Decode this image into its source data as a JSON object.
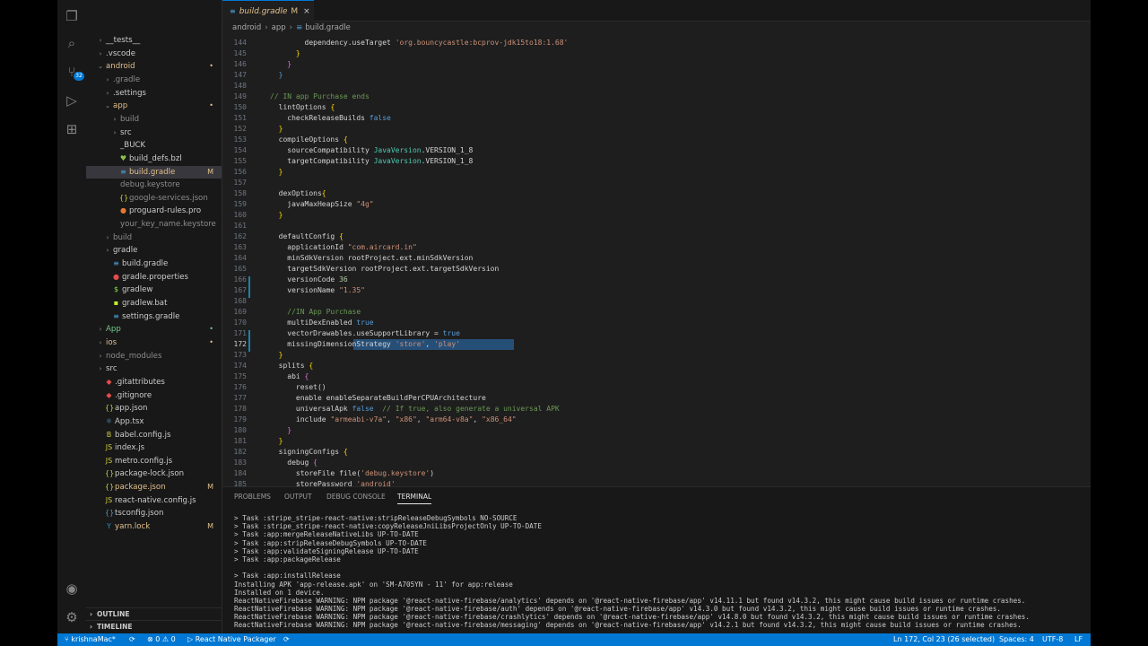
{
  "tab": {
    "icon": "gradle-icon",
    "label": "build.gradle",
    "status": "M",
    "close": "×"
  },
  "breadcrumb": [
    "android",
    "app",
    "build.gradle"
  ],
  "explorer": [
    {
      "depth": 1,
      "chev": "›",
      "label": "__tests__",
      "color": "#cccccc",
      "stat": ""
    },
    {
      "depth": 1,
      "chev": "›",
      "label": ".vscode",
      "color": "#cccccc",
      "stat": ""
    },
    {
      "depth": 1,
      "chev": "⌄",
      "label": "android",
      "color": "#e2c08d",
      "stat": "•"
    },
    {
      "depth": 2,
      "chev": "›",
      "label": ".gradle",
      "color": "#8c8c8c",
      "stat": ""
    },
    {
      "depth": 2,
      "chev": "›",
      "label": ".settings",
      "color": "#cccccc",
      "stat": ""
    },
    {
      "depth": 2,
      "chev": "⌄",
      "label": "app",
      "color": "#e2c08d",
      "stat": "•"
    },
    {
      "depth": 3,
      "chev": "›",
      "label": "build",
      "color": "#8c8c8c",
      "stat": ""
    },
    {
      "depth": 3,
      "chev": "›",
      "label": "src",
      "color": "#cccccc",
      "stat": ""
    },
    {
      "depth": 3,
      "chev": "",
      "label": "_BUCK",
      "color": "#cccccc",
      "stat": ""
    },
    {
      "depth": 3,
      "chev": "",
      "icon": "♥",
      "iconColor": "#8bc34a",
      "label": "build_defs.bzl",
      "color": "#cccccc",
      "stat": ""
    },
    {
      "depth": 3,
      "chev": "",
      "icon": "≡",
      "iconColor": "#4aa3d9",
      "label": "build.gradle",
      "color": "#e2c08d",
      "stat": "M",
      "sel": true
    },
    {
      "depth": 3,
      "chev": "",
      "label": "debug.keystore",
      "color": "#8c8c8c",
      "stat": ""
    },
    {
      "depth": 3,
      "chev": "",
      "icon": "{}",
      "iconColor": "#cbcb41",
      "label": "google-services.json",
      "color": "#8c8c8c",
      "stat": ""
    },
    {
      "depth": 3,
      "chev": "",
      "icon": "●",
      "iconColor": "#e37933",
      "label": "proguard-rules.pro",
      "color": "#cccccc",
      "stat": ""
    },
    {
      "depth": 3,
      "chev": "",
      "label": "your_key_name.keystore",
      "color": "#8c8c8c",
      "stat": ""
    },
    {
      "depth": 2,
      "chev": "›",
      "label": "build",
      "color": "#8c8c8c",
      "stat": ""
    },
    {
      "depth": 2,
      "chev": "›",
      "label": "gradle",
      "color": "#cccccc",
      "stat": ""
    },
    {
      "depth": 2,
      "chev": "",
      "icon": "≡",
      "iconColor": "#4aa3d9",
      "label": "build.gradle",
      "color": "#cccccc",
      "stat": ""
    },
    {
      "depth": 2,
      "chev": "",
      "icon": "●",
      "iconColor": "#e34c4c",
      "label": "gradle.properties",
      "color": "#cccccc",
      "stat": ""
    },
    {
      "depth": 2,
      "chev": "",
      "icon": "$",
      "iconColor": "#89e051",
      "label": "gradlew",
      "color": "#cccccc",
      "stat": ""
    },
    {
      "depth": 2,
      "chev": "",
      "icon": "▪",
      "iconColor": "#c1f12e",
      "label": "gradlew.bat",
      "color": "#cccccc",
      "stat": ""
    },
    {
      "depth": 2,
      "chev": "",
      "icon": "≡",
      "iconColor": "#4aa3d9",
      "label": "settings.gradle",
      "color": "#cccccc",
      "stat": ""
    },
    {
      "depth": 1,
      "chev": "›",
      "label": "App",
      "color": "#73c991",
      "stat": "•",
      "statColor": "#73c991"
    },
    {
      "depth": 1,
      "chev": "›",
      "label": "ios",
      "color": "#e2c08d",
      "stat": "•"
    },
    {
      "depth": 1,
      "chev": "›",
      "label": "node_modules",
      "color": "#8c8c8c",
      "stat": ""
    },
    {
      "depth": 1,
      "chev": "›",
      "label": "src",
      "color": "#cccccc",
      "stat": ""
    },
    {
      "depth": 1,
      "chev": "",
      "icon": "◆",
      "iconColor": "#e34c4c",
      "label": ".gitattributes",
      "color": "#cccccc",
      "stat": ""
    },
    {
      "depth": 1,
      "chev": "",
      "icon": "◆",
      "iconColor": "#e34c4c",
      "label": ".gitignore",
      "color": "#cccccc",
      "stat": ""
    },
    {
      "depth": 1,
      "chev": "",
      "icon": "{}",
      "iconColor": "#cbcb41",
      "label": "app.json",
      "color": "#cccccc",
      "stat": ""
    },
    {
      "depth": 1,
      "chev": "",
      "icon": "⚛",
      "iconColor": "#519aba",
      "label": "App.tsx",
      "color": "#cccccc",
      "stat": ""
    },
    {
      "depth": 1,
      "chev": "",
      "icon": "B",
      "iconColor": "#cbcb41",
      "label": "babel.config.js",
      "color": "#cccccc",
      "stat": ""
    },
    {
      "depth": 1,
      "chev": "",
      "icon": "JS",
      "iconColor": "#cbcb41",
      "label": "index.js",
      "color": "#cccccc",
      "stat": ""
    },
    {
      "depth": 1,
      "chev": "",
      "icon": "JS",
      "iconColor": "#cbcb41",
      "label": "metro.config.js",
      "color": "#cccccc",
      "stat": ""
    },
    {
      "depth": 1,
      "chev": "",
      "icon": "{}",
      "iconColor": "#cbcb41",
      "label": "package-lock.json",
      "color": "#cccccc",
      "stat": ""
    },
    {
      "depth": 1,
      "chev": "",
      "icon": "{}",
      "iconColor": "#cbcb41",
      "label": "package.json",
      "color": "#e2c08d",
      "stat": "M"
    },
    {
      "depth": 1,
      "chev": "",
      "icon": "JS",
      "iconColor": "#cbcb41",
      "label": "react-native.config.js",
      "color": "#cccccc",
      "stat": ""
    },
    {
      "depth": 1,
      "chev": "",
      "icon": "{}",
      "iconColor": "#519aba",
      "label": "tsconfig.json",
      "color": "#cccccc",
      "stat": ""
    },
    {
      "depth": 1,
      "chev": "",
      "icon": "Y",
      "iconColor": "#2c8ebb",
      "label": "yarn.lock",
      "color": "#e2c08d",
      "stat": "M"
    }
  ],
  "sections": {
    "outline": "OUTLINE",
    "timeline": "TIMELINE"
  },
  "code": [
    {
      "n": "144",
      "segs": [
        [
          "        dependency.useTarget ",
          ""
        ],
        [
          "'org.bouncycastle:bcprov-jdk15to18:1.68'",
          "str"
        ]
      ]
    },
    {
      "n": "145",
      "segs": [
        [
          "      }",
          "brace2"
        ]
      ]
    },
    {
      "n": "146",
      "segs": [
        [
          "    }",
          "brace"
        ]
      ]
    },
    {
      "n": "147",
      "segs": [
        [
          "  }",
          "kw"
        ]
      ]
    },
    {
      "n": "148",
      "segs": [
        [
          "",
          ""
        ]
      ]
    },
    {
      "n": "149",
      "segs": [
        [
          "// IN app Purchase ends",
          "cmt"
        ]
      ]
    },
    {
      "n": "150",
      "segs": [
        [
          "  lintOptions ",
          ""
        ],
        [
          "{",
          "brace2"
        ]
      ]
    },
    {
      "n": "151",
      "segs": [
        [
          "    checkReleaseBuilds ",
          ""
        ],
        [
          "false",
          "kw"
        ]
      ]
    },
    {
      "n": "152",
      "segs": [
        [
          "  }",
          "brace2"
        ]
      ]
    },
    {
      "n": "153",
      "segs": [
        [
          "  compileOptions ",
          ""
        ],
        [
          "{",
          "brace2"
        ]
      ]
    },
    {
      "n": "154",
      "segs": [
        [
          "    sourceCompatibility ",
          ""
        ],
        [
          "JavaVersion",
          "type"
        ],
        [
          ".VERSION_1_8",
          ""
        ]
      ]
    },
    {
      "n": "155",
      "segs": [
        [
          "    targetCompatibility ",
          ""
        ],
        [
          "JavaVersion",
          "type"
        ],
        [
          ".VERSION_1_8",
          ""
        ]
      ]
    },
    {
      "n": "156",
      "segs": [
        [
          "  }",
          "brace2"
        ]
      ]
    },
    {
      "n": "157",
      "segs": [
        [
          "",
          ""
        ]
      ]
    },
    {
      "n": "158",
      "segs": [
        [
          "  dexOptions",
          ""
        ],
        [
          "{",
          "brace2"
        ]
      ]
    },
    {
      "n": "159",
      "segs": [
        [
          "    javaMaxHeapSize ",
          ""
        ],
        [
          "\"4g\"",
          "str"
        ]
      ]
    },
    {
      "n": "160",
      "segs": [
        [
          "  }",
          "brace2"
        ]
      ]
    },
    {
      "n": "161",
      "segs": [
        [
          "",
          ""
        ]
      ]
    },
    {
      "n": "162",
      "segs": [
        [
          "  defaultConfig ",
          ""
        ],
        [
          "{",
          "brace2"
        ]
      ]
    },
    {
      "n": "163",
      "segs": [
        [
          "    applicationId ",
          ""
        ],
        [
          "\"com.aircard.in\"",
          "str"
        ]
      ]
    },
    {
      "n": "164",
      "segs": [
        [
          "    minSdkVersion rootProject.ext.minSdkVersion",
          ""
        ]
      ]
    },
    {
      "n": "165",
      "segs": [
        [
          "    targetSdkVersion rootProject.ext.targetSdkVersion",
          ""
        ]
      ]
    },
    {
      "n": "166",
      "segs": [
        [
          "    versionCode ",
          ""
        ],
        [
          "36",
          "num"
        ]
      ]
    },
    {
      "n": "167",
      "segs": [
        [
          "    versionName ",
          ""
        ],
        [
          "\"1.35\"",
          "str"
        ]
      ]
    },
    {
      "n": "168",
      "segs": [
        [
          "",
          ""
        ]
      ]
    },
    {
      "n": "169",
      "segs": [
        [
          "    //IN App Purchase",
          "cmt"
        ]
      ]
    },
    {
      "n": "170",
      "segs": [
        [
          "    multiDexEnabled ",
          ""
        ],
        [
          "true",
          "kw"
        ]
      ]
    },
    {
      "n": "171",
      "segs": [
        [
          "    vectorDrawables.useSupportLibrary = ",
          ""
        ],
        [
          "true",
          "kw"
        ]
      ]
    },
    {
      "n": "172",
      "segs": [
        [
          "    missingDimensionStrategy ",
          ""
        ],
        [
          "'store'",
          "str"
        ],
        [
          ", ",
          ""
        ],
        [
          "'play'",
          "str"
        ]
      ],
      "cur": true
    },
    {
      "n": "173",
      "segs": [
        [
          "  }",
          "brace2"
        ]
      ]
    },
    {
      "n": "174",
      "segs": [
        [
          "  splits ",
          ""
        ],
        [
          "{",
          "brace2"
        ]
      ]
    },
    {
      "n": "175",
      "segs": [
        [
          "    abi ",
          ""
        ],
        [
          "{",
          "brace"
        ]
      ]
    },
    {
      "n": "176",
      "segs": [
        [
          "      reset()",
          ""
        ]
      ]
    },
    {
      "n": "177",
      "segs": [
        [
          "      enable enableSeparateBuildPerCPUArchitecture",
          ""
        ]
      ]
    },
    {
      "n": "178",
      "segs": [
        [
          "      universalApk ",
          ""
        ],
        [
          "false",
          "kw"
        ],
        [
          "  // If true, also generate a universal APK",
          "cmt"
        ]
      ]
    },
    {
      "n": "179",
      "segs": [
        [
          "      include ",
          ""
        ],
        [
          "\"armeabi-v7a\"",
          "str"
        ],
        [
          ", ",
          ""
        ],
        [
          "\"x86\"",
          "str"
        ],
        [
          ", ",
          ""
        ],
        [
          "\"arm64-v8a\"",
          "str"
        ],
        [
          ", ",
          ""
        ],
        [
          "\"x86_64\"",
          "str"
        ]
      ]
    },
    {
      "n": "180",
      "segs": [
        [
          "    }",
          "brace"
        ]
      ]
    },
    {
      "n": "181",
      "segs": [
        [
          "  }",
          "brace2"
        ]
      ]
    },
    {
      "n": "182",
      "segs": [
        [
          "  signingConfigs ",
          ""
        ],
        [
          "{",
          "brace2"
        ]
      ]
    },
    {
      "n": "183",
      "segs": [
        [
          "    debug ",
          ""
        ],
        [
          "{",
          "brace"
        ]
      ]
    },
    {
      "n": "184",
      "segs": [
        [
          "      storeFile file(",
          ""
        ],
        [
          "'debug.keystore'",
          "str"
        ],
        [
          ")",
          ""
        ]
      ]
    },
    {
      "n": "185",
      "segs": [
        [
          "      storePassword ",
          ""
        ],
        [
          "'android'",
          "str"
        ]
      ]
    }
  ],
  "panel": {
    "tabs": [
      "PROBLEMS",
      "OUTPUT",
      "DEBUG CONSOLE",
      "TERMINAL"
    ],
    "active_tab": "TERMINAL",
    "terminal": [
      "> Task :stripe_stripe-react-native:stripReleaseDebugSymbols NO-SOURCE",
      "> Task :stripe_stripe-react-native:copyReleaseJniLibsProjectOnly UP-TO-DATE",
      "> Task :app:mergeReleaseNativeLibs UP-TO-DATE",
      "> Task :app:stripReleaseDebugSymbols UP-TO-DATE",
      "> Task :app:validateSigningRelease UP-TO-DATE",
      "> Task :app:packageRelease",
      "",
      "> Task :app:installRelease",
      "Installing APK 'app-release.apk' on 'SM-A705YN - 11' for app:release",
      "Installed on 1 device.",
      "ReactNativeFirebase WARNING: NPM package '@react-native-firebase/analytics' depends on '@react-native-firebase/app' v14.11.1 but found v14.3.2, this might cause build issues or runtime crashes.",
      "ReactNativeFirebase WARNING: NPM package '@react-native-firebase/auth' depends on '@react-native-firebase/app' v14.3.0 but found v14.3.2, this might cause build issues or runtime crashes.",
      "ReactNativeFirebase WARNING: NPM package '@react-native-firebase/crashlytics' depends on '@react-native-firebase/app' v14.8.0 but found v14.3.2, this might cause build issues or runtime crashes.",
      "ReactNativeFirebase WARNING: NPM package '@react-native-firebase/messaging' depends on '@react-native-firebase/app' v14.2.1 but found v14.3.2, this might cause build issues or runtime crashes."
    ]
  },
  "status": {
    "branch": "krishnaMac*",
    "sync_icon": "sync-icon",
    "errors": "0",
    "warnings": "0",
    "packager": "React Native Packager",
    "cursor": "Ln 172, Col 23 (26 selected)",
    "spaces": "Spaces: 4",
    "encoding": "UTF-8",
    "eol": "LF"
  },
  "activity_badge": "32"
}
